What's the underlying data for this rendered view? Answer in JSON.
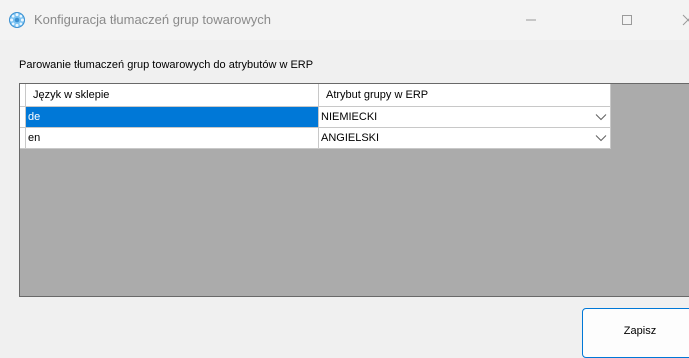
{
  "window": {
    "title": "Konfiguracja tłumaczeń grup towarowych",
    "icon": "gear-icon",
    "accent": "#4ea8e8"
  },
  "main": {
    "group_label": "Parowanie tłumaczeń grup towarowych do atrybutów w ERP",
    "columns": [
      "Język w sklepie",
      "Atrybut grupy w ERP"
    ],
    "rows": [
      {
        "lang": "de",
        "attr": "NIEMIECKI"
      },
      {
        "lang": "en",
        "attr": "ANGIELSKI"
      }
    ],
    "selection_color": "#0078d7"
  },
  "footer": {
    "save_label": "Zapisz"
  }
}
